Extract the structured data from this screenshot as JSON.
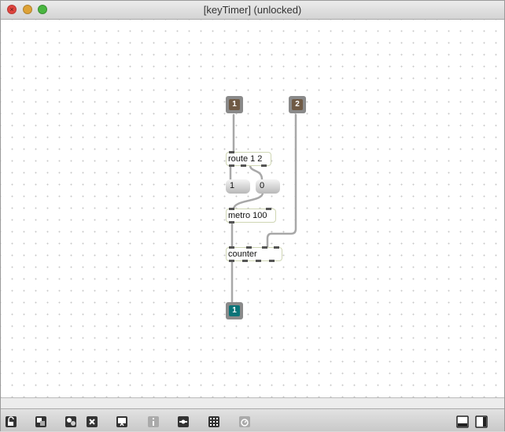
{
  "window": {
    "title": "[keyTimer] (unlocked)"
  },
  "patch": {
    "inlets": [
      {
        "label": "1"
      },
      {
        "label": "2"
      }
    ],
    "outlet": {
      "label": "1"
    },
    "objects": {
      "route": "route 1 2",
      "metro": "metro 100",
      "counter": "counter"
    },
    "messages": {
      "one": "1",
      "zero": "0"
    }
  },
  "toolbar": {
    "icons": [
      "lock-icon",
      "presentation-icon",
      "new-object-icon",
      "close-object-icon",
      "paint-icon",
      "info-icon",
      "inspector-icon",
      "grid-icon",
      "snap-icon",
      "patcher-view-icon",
      "presentation-view-icon"
    ]
  },
  "colors": {
    "inlet": "#6f5a45",
    "outlet": "#0a7478",
    "wire": "#a8a8a8"
  }
}
